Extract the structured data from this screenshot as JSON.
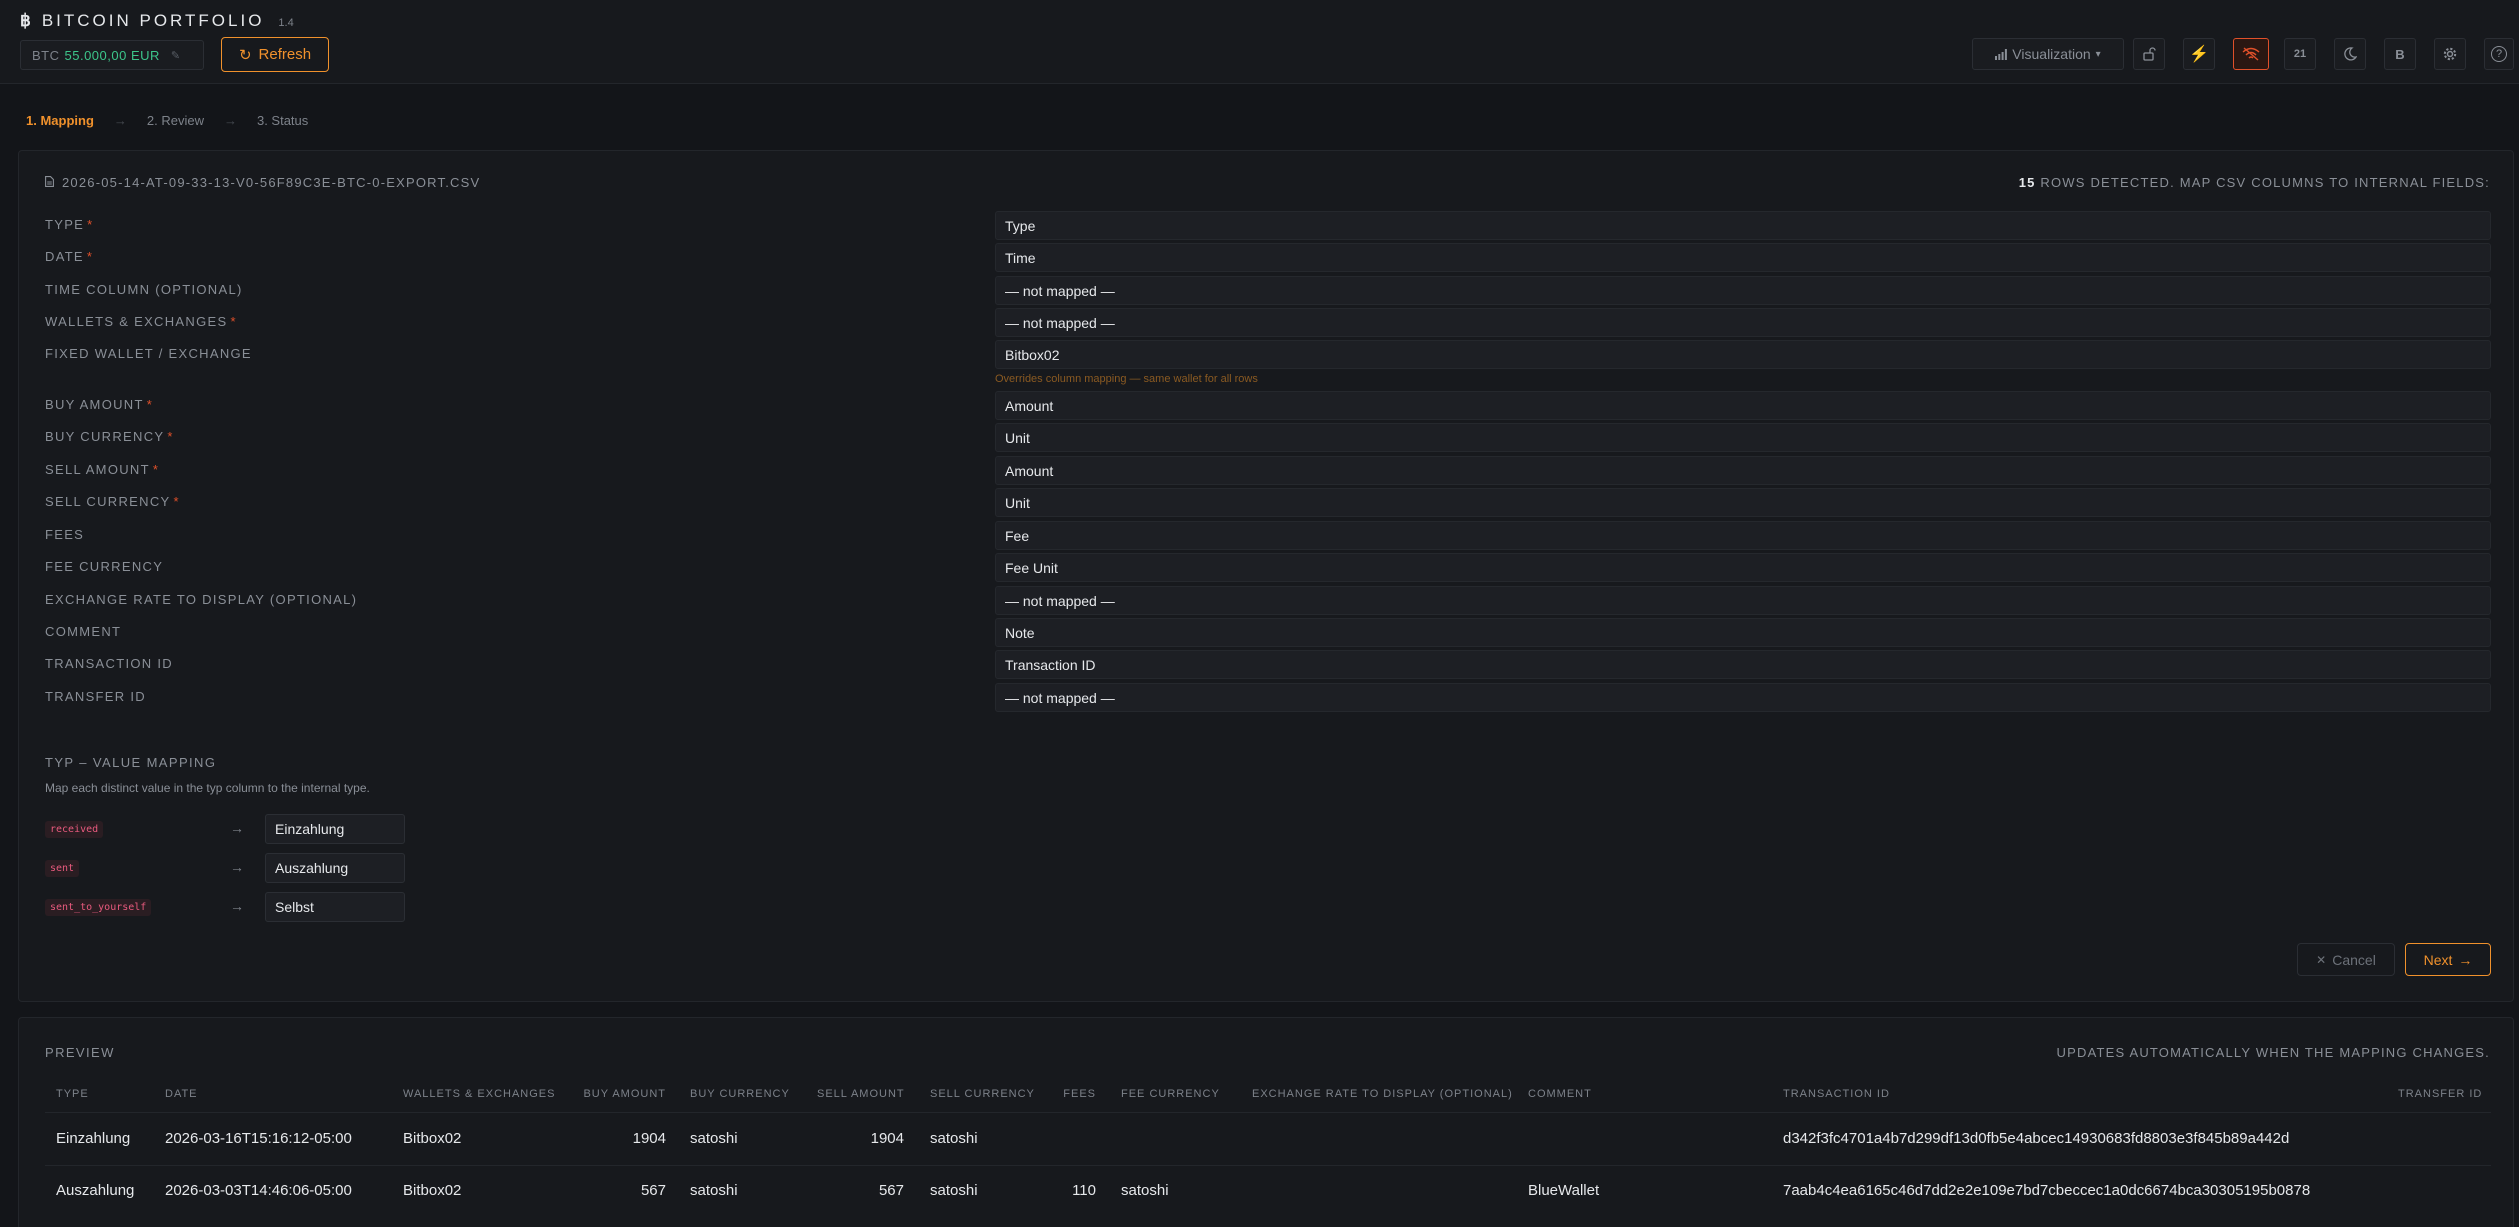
{
  "header": {
    "btc_symbol": "฿",
    "title": "BITCOIN PORTFOLIO",
    "version": "1.4",
    "price_label": "BTC",
    "price_value": "55.000,00 EUR",
    "edit_icon": "✎",
    "refresh_icon": "↻",
    "refresh_label": "Refresh",
    "visualization_label": "Visualization",
    "visualization_caret": "▾",
    "tool_block_label": "21",
    "tool_b_label": "B",
    "help_icon": "?",
    "accent_color": "#f0912c",
    "price_color": "#3cc58a"
  },
  "steps": {
    "step1": "1. Mapping",
    "step2": "2. Review",
    "step3": "3. Status",
    "arrow": "→"
  },
  "mapping": {
    "file_name": "2026-05-14-AT-09-33-13-V0-56F89C3E-BTC-0-EXPORT.CSV",
    "rows_count": "15",
    "rows_text": "ROWS DETECTED. MAP CSV COLUMNS TO INTERNAL FIELDS:",
    "required_mark": "*",
    "fields": [
      {
        "label": "TYPE",
        "value": "Type"
      },
      {
        "label": "DATE",
        "value": "Time"
      },
      {
        "label": "TIME COLUMN (OPTIONAL)",
        "value": "— not mapped —"
      },
      {
        "label": "WALLETS & EXCHANGES",
        "value": "— not mapped —"
      },
      {
        "label": "FIXED WALLET / EXCHANGE",
        "value": "Bitbox02"
      },
      {
        "label": "BUY AMOUNT",
        "value": "Amount"
      },
      {
        "label": "BUY CURRENCY",
        "value": "Unit"
      },
      {
        "label": "SELL AMOUNT",
        "value": "Amount"
      },
      {
        "label": "SELL CURRENCY",
        "value": "Unit"
      },
      {
        "label": "FEES",
        "value": "Fee"
      },
      {
        "label": "FEE CURRENCY",
        "value": "Fee Unit"
      },
      {
        "label": "EXCHANGE RATE TO DISPLAY (OPTIONAL)",
        "value": "— not mapped —"
      },
      {
        "label": "COMMENT",
        "value": "Note"
      },
      {
        "label": "TRANSACTION ID",
        "value": "Transaction ID"
      },
      {
        "label": "TRANSFER ID",
        "value": "— not mapped —"
      }
    ],
    "fixed_wallet_hint": "Overrides column mapping — same wallet for all rows"
  },
  "value_mapping": {
    "title": "TYP – VALUE MAPPING",
    "description": "Map each distinct value in the typ column to the internal type.",
    "arrow": "→",
    "rows": [
      {
        "source": "received",
        "target": "Einzahlung"
      },
      {
        "source": "sent",
        "target": "Auszahlung"
      },
      {
        "source": "sent_to_yourself",
        "target": "Selbst"
      }
    ]
  },
  "actions": {
    "cancel_icon": "✕",
    "cancel_label": "Cancel",
    "next_label": "Next",
    "next_icon": "→"
  },
  "preview": {
    "title": "PREVIEW",
    "note": "UPDATES AUTOMATICALLY WHEN THE MAPPING CHANGES.",
    "columns": [
      "TYPE",
      "DATE",
      "WALLETS & EXCHANGES",
      "BUY AMOUNT",
      "BUY CURRENCY",
      "SELL AMOUNT",
      "SELL CURRENCY",
      "FEES",
      "FEE CURRENCY",
      "EXCHANGE RATE TO DISPLAY (OPTIONAL)",
      "COMMENT",
      "TRANSACTION ID",
      "TRANSFER ID"
    ],
    "rows": [
      [
        "Einzahlung",
        "2026-03-16T15:16:12-05:00",
        "Bitbox02",
        "1904",
        "satoshi",
        "1904",
        "satoshi",
        "",
        "",
        "",
        "",
        "d342f3fc4701a4b7d299df13d0fb5e4abcec14930683fd8803e3f845b89a442d",
        ""
      ],
      [
        "Auszahlung",
        "2026-03-03T14:46:06-05:00",
        "Bitbox02",
        "567",
        "satoshi",
        "567",
        "satoshi",
        "110",
        "satoshi",
        "",
        "BlueWallet",
        "7aab4c4ea6165c46d7dd2e2e109e7bd7cbeccec1a0dc6674bca30305195b0878",
        ""
      ]
    ]
  }
}
